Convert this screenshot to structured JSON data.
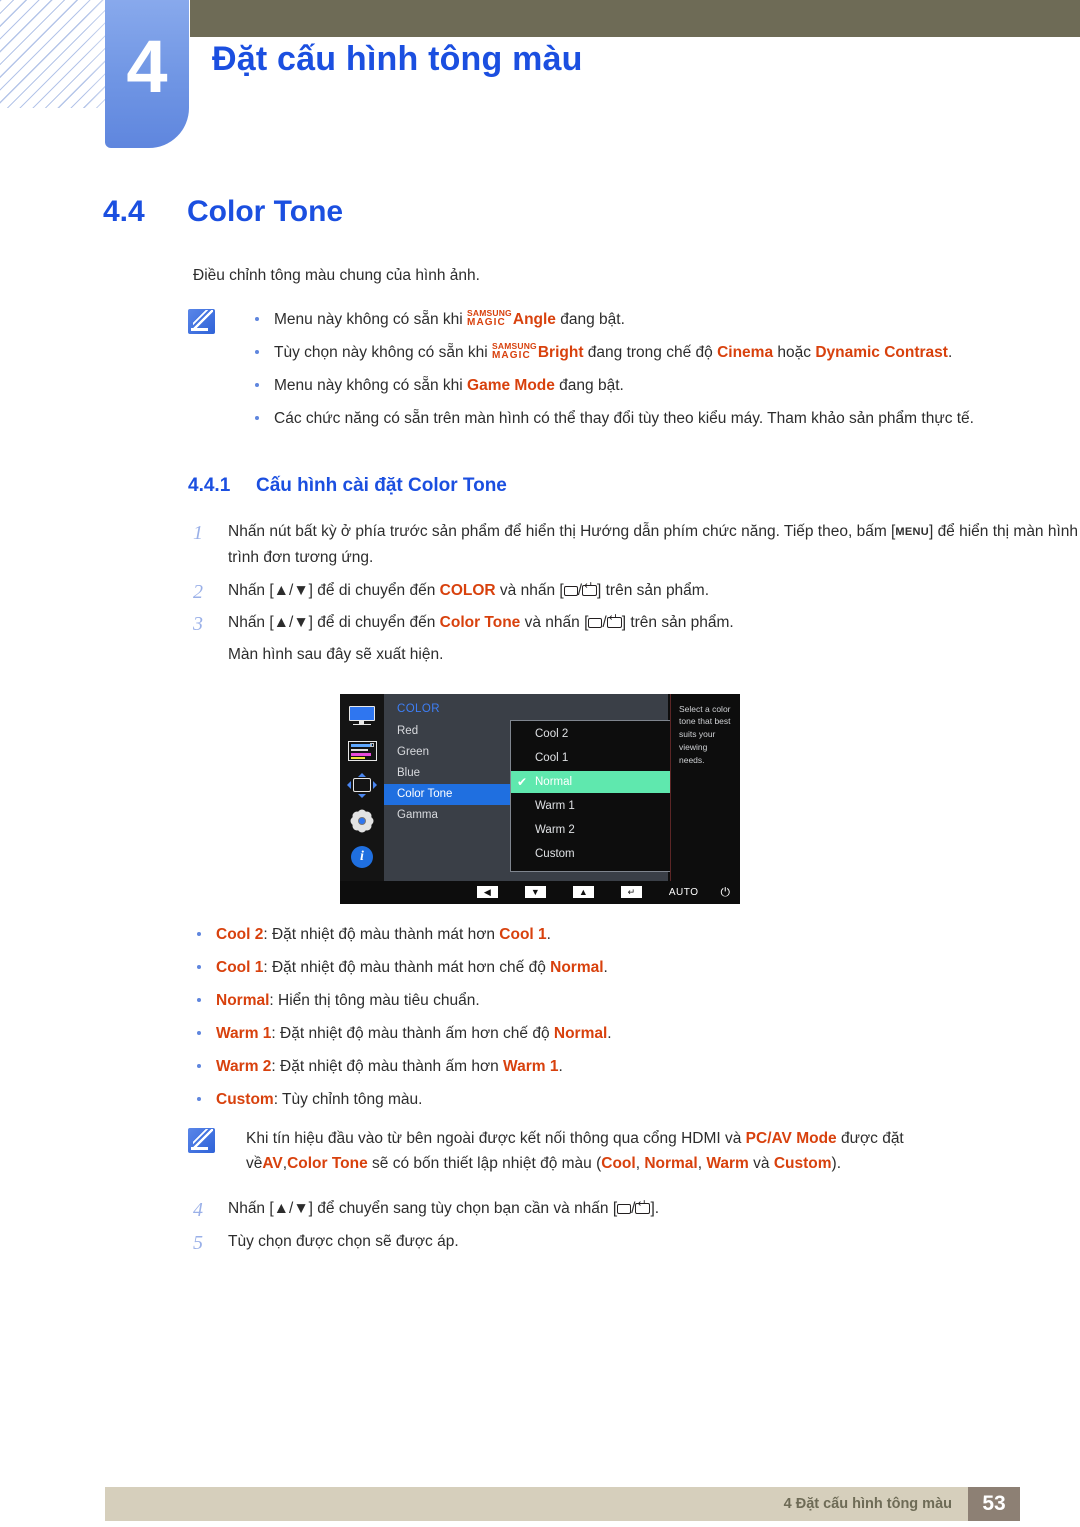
{
  "header": {
    "chapter_number": "4",
    "chapter_title": "Đặt cấu hình tông màu"
  },
  "section": {
    "number": "4.4",
    "title": "Color Tone",
    "intro": "Điều chỉnh tông màu chung của hình ảnh."
  },
  "note_top": {
    "icon": "note-pen-icon",
    "bullets": [
      {
        "pre": "Menu này không có sẵn khi ",
        "magic_sup": "SAMSUNG",
        "magic_sub": "MAGIC",
        "magic_word": "Angle",
        "post": " đang bật."
      },
      {
        "pre": "Tùy chọn này không có sẵn khi ",
        "magic_sup": "SAMSUNG",
        "magic_sub": "MAGIC",
        "magic_word": "Bright",
        "mid": " đang trong chế độ ",
        "em1": "Cinema",
        "mid2": " hoặc ",
        "em2": "Dynamic Contrast",
        "post": "."
      },
      {
        "pre": "Menu này không có sẵn khi ",
        "em1": "Game Mode",
        "post": " đang bật."
      },
      {
        "plain": "Các chức năng có sẵn trên màn hình có thể thay đổi tùy theo kiểu máy. Tham khảo sản phẩm thực tế."
      }
    ]
  },
  "subsection": {
    "number": "4.4.1",
    "title": "Cấu hình cài đặt Color Tone"
  },
  "steps": [
    {
      "n": "1",
      "text_a": "Nhấn nút bất kỳ ở phía trước sản phẩm để hiển thị Hướng dẫn phím chức năng. Tiếp theo, bấm [",
      "key": "MENU",
      "text_b": "] để hiển thị màn hình trình đơn tương ứng."
    },
    {
      "n": "2",
      "text_a": "Nhấn [▲/▼] để di chuyển đến ",
      "em": "COLOR",
      "text_b": " và nhấn [",
      "text_c": "] trên sản phẩm."
    },
    {
      "n": "3",
      "text_a": "Nhấn [▲/▼] để di chuyển đến ",
      "em": "Color Tone",
      "text_b": " và nhấn [",
      "text_c": "] trên sản phẩm.",
      "extra": "Màn hình sau đây sẽ xuất hiện."
    }
  ],
  "osd": {
    "menu_title": "COLOR",
    "menu_items": [
      "Red",
      "Green",
      "Blue",
      "Color Tone",
      "Gamma"
    ],
    "selected_menu_item": "Color Tone",
    "dropdown_options": [
      "Cool 2",
      "Cool 1",
      "Normal",
      "Warm 1",
      "Warm 2",
      "Custom"
    ],
    "selected_option": "Normal",
    "checkmark": "✔",
    "help_text": "Select a color tone that best suits your viewing needs.",
    "icons": [
      "monitor-icon",
      "color-bars-icon",
      "size-position-icon",
      "gear-icon",
      "info-icon"
    ],
    "bottom_bar": {
      "left_key": "◀",
      "down_key": "▼",
      "up_key": "▲",
      "enter_key": "↵",
      "auto_label": "AUTO",
      "power_icon": "⏻"
    },
    "colors": {
      "menu_bg": "#3a3f47",
      "panel_bg": "#0d0d0d",
      "selected_blue": "#1f6fe0",
      "selected_green": "#5fe8ae",
      "title_blue": "#3d7ef5"
    }
  },
  "option_bullets": [
    {
      "term": "Cool 2",
      "mid": ": Đặt nhiệt độ màu thành mát hơn ",
      "term2": "Cool 1",
      "post": "."
    },
    {
      "term": "Cool 1",
      "mid": ": Đặt nhiệt độ màu thành mát hơn chế độ ",
      "term2": "Normal",
      "post": "."
    },
    {
      "term": "Normal",
      "mid": ": Hiển thị tông màu tiêu chuẩn.",
      "term2": "",
      "post": ""
    },
    {
      "term": "Warm 1",
      "mid": ": Đặt nhiệt độ màu thành ấm hơn chế độ ",
      "term2": "Normal",
      "post": "."
    },
    {
      "term": "Warm 2",
      "mid": ": Đặt nhiệt độ màu thành ấm hơn ",
      "term2": "Warm 1",
      "post": "."
    },
    {
      "term": "Custom",
      "mid": ": Tùy chỉnh tông màu.",
      "term2": "",
      "post": ""
    }
  ],
  "note_bottom": {
    "icon": "note-pen-icon",
    "a": "Khi tín hiệu đầu vào từ bên ngoài được kết nối thông qua cổng HDMI và ",
    "em1": "PC/AV Mode",
    "b": " được đặt về",
    "em2": "AV",
    "c": ",",
    "em3": "Color Tone",
    "d": " sẽ có bốn thiết lập nhiệt độ màu (",
    "em4": "Cool",
    "e": ", ",
    "em5": "Normal",
    "f": ", ",
    "em6": "Warm",
    "g": " và ",
    "em7": "Custom",
    "h": ")."
  },
  "steps_tail": [
    {
      "n": "4",
      "text_a": "Nhấn [▲/▼] để chuyển sang tùy chọn bạn cần và nhấn [",
      "text_b": "]."
    },
    {
      "n": "5",
      "text_a": "Tùy chọn được chọn sẽ được áp.",
      "text_b": ""
    }
  ],
  "footer": {
    "text": "4 Đặt cấu hình tông màu",
    "page": "53"
  }
}
